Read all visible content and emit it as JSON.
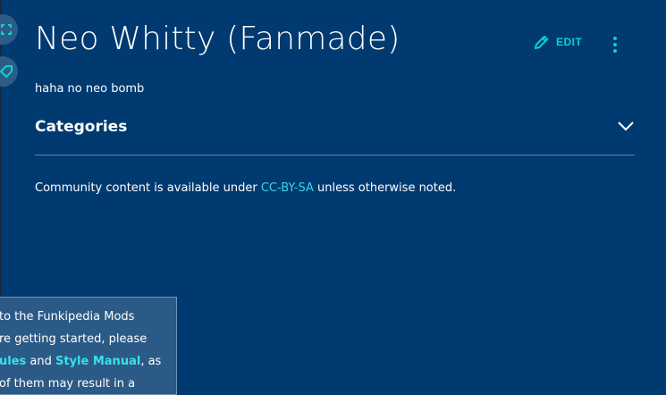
{
  "page": {
    "title": "Neo Whitty (Fanmade)",
    "text": "haha no neo bomb"
  },
  "toolbar": {
    "edit_label": "EDIT",
    "edit_icon": "pencil-icon",
    "more_icon": "more-vertical-icon"
  },
  "rail": {
    "button_1_icon": "expand-icon",
    "button_2_icon": "tag-icon"
  },
  "categories": {
    "label": "Categories",
    "icon": "chevron-down-icon"
  },
  "license": {
    "prefix": "Community content is available under ",
    "link": "CC-BY-SA",
    "suffix": " unless otherwise noted."
  },
  "welcome": {
    "line1": "to the Funkipedia Mods",
    "line2": "re getting started, please",
    "line3_link1": "ules",
    "line3_mid": " and ",
    "line3_link2": "Style Manual",
    "line3_suffix": ", as",
    "line4": "of them may result in a"
  },
  "colors": {
    "background": "#013a70",
    "accent": "#00d6d6",
    "link": "#3ad4e8",
    "divider": "#4c86b8",
    "welcome_box": "#2c5a87"
  }
}
